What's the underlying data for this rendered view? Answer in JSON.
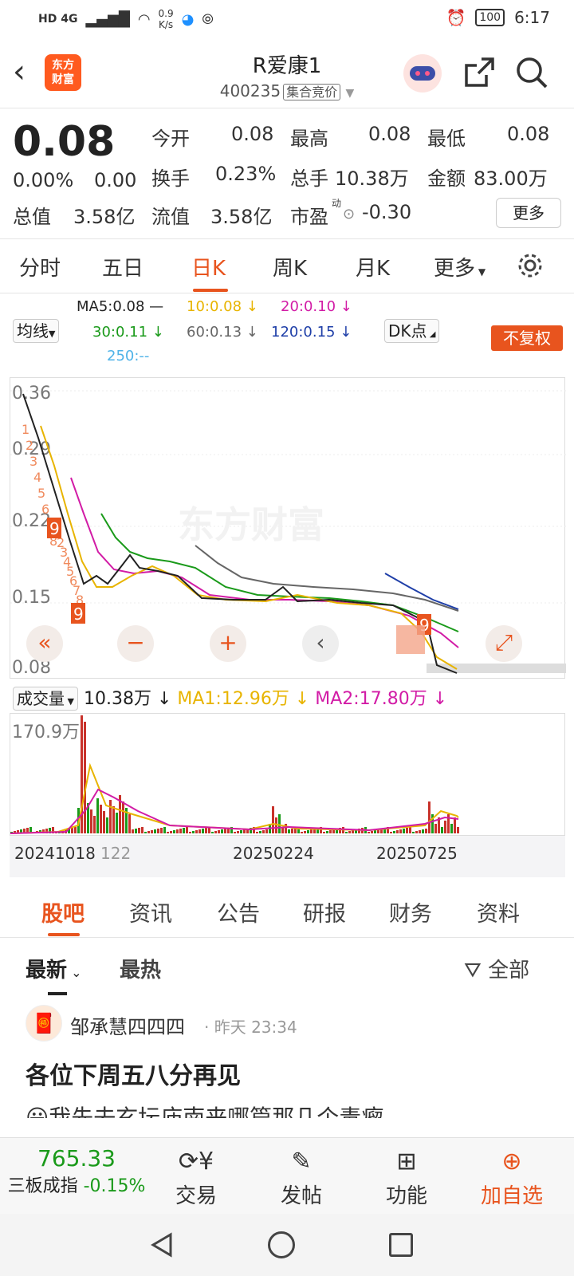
{
  "status_bar": {
    "network": "HD 4G",
    "speed_value": "0.9",
    "speed_unit": "K/s",
    "battery": "100",
    "time": "6:17"
  },
  "header": {
    "title": "R爱康1",
    "code": "400235",
    "code_tag": "集合竞价",
    "logo_line1": "东方",
    "logo_line2": "财富"
  },
  "quote": {
    "price": "0.08",
    "change_pct": "0.00%",
    "change": "0.00",
    "open_label": "今开",
    "open": "0.08",
    "high_label": "最高",
    "high": "0.08",
    "low_label": "最低",
    "low": "0.08",
    "turnover_label": "换手",
    "turnover": "0.23%",
    "volume_label": "总手",
    "volume": "10.38万",
    "amount_label": "金额",
    "amount": "83.00万",
    "mktcap_label": "总值",
    "mktcap": "3.58亿",
    "float_label": "流值",
    "float_cap": "3.58亿",
    "pe_label": "市盈",
    "pe_sup": "动",
    "pe": "-0.30",
    "more": "更多"
  },
  "tabs": [
    {
      "label": "分时"
    },
    {
      "label": "五日"
    },
    {
      "label": "日K"
    },
    {
      "label": "周K"
    },
    {
      "label": "月K"
    },
    {
      "label": "更多"
    }
  ],
  "ma": {
    "ma5": "MA5:0.08",
    "ma10": "10:0.08",
    "ma20": "20:0.10",
    "ma30": "30:0.11",
    "ma60": "60:0.13",
    "ma120": "120:0.15",
    "ma250": "250:--",
    "avg_line_btn": "均线",
    "dk_btn": "DK点",
    "fuquan": "不复权",
    "colors": {
      "ma5": "#222222",
      "ma10": "#e8b400",
      "ma20": "#d21ca6",
      "ma30": "#1a9a1a",
      "ma60": "#666666",
      "ma120": "#1f3fa8",
      "ma250": "#4fb3e8",
      "accent": "#e8541e"
    }
  },
  "kchart": {
    "y_labels": [
      "0.36",
      "0.29",
      "0.22",
      "0.15",
      "0.08"
    ],
    "watermark": "东方财富",
    "count_marks": [
      "1",
      "2",
      "3",
      "4",
      "5",
      "6",
      "7",
      "8",
      "9"
    ],
    "nine_label": "9"
  },
  "volume": {
    "btn": "成交量",
    "value": "10.38万",
    "ma1": "MA1:12.96万",
    "ma2": "MA2:17.80万",
    "max_label": "170.9万"
  },
  "dates": {
    "d1": "20241018",
    "d1_extra": "122",
    "d2": "20250224",
    "d3": "20250725"
  },
  "subtabs": [
    {
      "label": "股吧"
    },
    {
      "label": "资讯"
    },
    {
      "label": "公告"
    },
    {
      "label": "研报"
    },
    {
      "label": "财务"
    },
    {
      "label": "资料"
    }
  ],
  "post_filter": {
    "latest": "最新",
    "hot": "最热",
    "all": "全部"
  },
  "post": {
    "author": "邹承慧四四四",
    "time": "· 昨天 23:34",
    "title": "各位下周五八分再见",
    "preview": "😀我先去玄坛庙南来哪篇那几个毒瘤"
  },
  "bottom_nav": {
    "index_value": "765.33",
    "index_name": "三板成指",
    "index_change": "-0.15%",
    "trade": "交易",
    "post": "发帖",
    "functions": "功能",
    "add": "加自选"
  }
}
